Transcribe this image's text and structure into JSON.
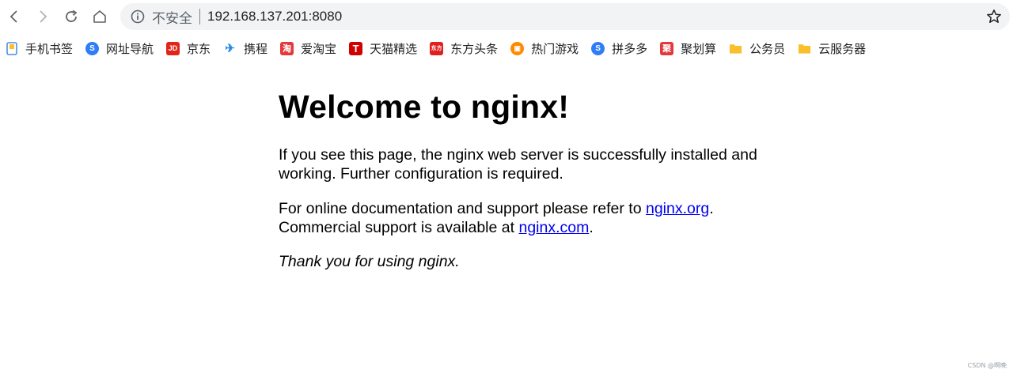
{
  "browser": {
    "security_label": "不安全",
    "url": "192.168.137.201:8080"
  },
  "bookmarks": [
    {
      "label": "手机书签",
      "icon": "phone-bookmark-icon",
      "color": "#4a90e2",
      "glyph": ""
    },
    {
      "label": "网址导航",
      "icon": "navigation-icon",
      "color": "#2f7df6",
      "glyph": "S"
    },
    {
      "label": "京东",
      "icon": "jd-icon",
      "color": "#e1251b",
      "glyph": "JD"
    },
    {
      "label": "携程",
      "icon": "ctrip-icon",
      "color": "#1e88e5",
      "glyph": "✈"
    },
    {
      "label": "爱淘宝",
      "icon": "taobao-icon",
      "color": "#e4393c",
      "glyph": "淘"
    },
    {
      "label": "天猫精选",
      "icon": "tmall-icon",
      "color": "#d10000",
      "glyph": "T"
    },
    {
      "label": "东方头条",
      "icon": "dongfang-icon",
      "color": "#e02020",
      "glyph": "东方"
    },
    {
      "label": "热门游戏",
      "icon": "game-icon",
      "color": "#ff8a00",
      "glyph": "▣"
    },
    {
      "label": "拼多多",
      "icon": "pinduoduo-icon",
      "color": "#2f7df6",
      "glyph": "S"
    },
    {
      "label": "聚划算",
      "icon": "juhuasuan-icon",
      "color": "#e4393c",
      "glyph": "聚"
    },
    {
      "label": "公务员",
      "icon": "folder-icon",
      "color": "#f9c02b",
      "glyph": ""
    },
    {
      "label": "云服务器",
      "icon": "folder-icon",
      "color": "#f9c02b",
      "glyph": ""
    }
  ],
  "page": {
    "heading": "Welcome to nginx!",
    "p1": "If you see this page, the nginx web server is successfully installed and working. Further configuration is required.",
    "p2_before_org": "For online documentation and support please refer to ",
    "link_org": "nginx.org",
    "p2_after_org": ".",
    "p2_before_com": "Commercial support is available at ",
    "link_com": "nginx.com",
    "p2_after_com": ".",
    "p3": "Thank you for using nginx."
  },
  "watermark": "CSDN @啊晚"
}
